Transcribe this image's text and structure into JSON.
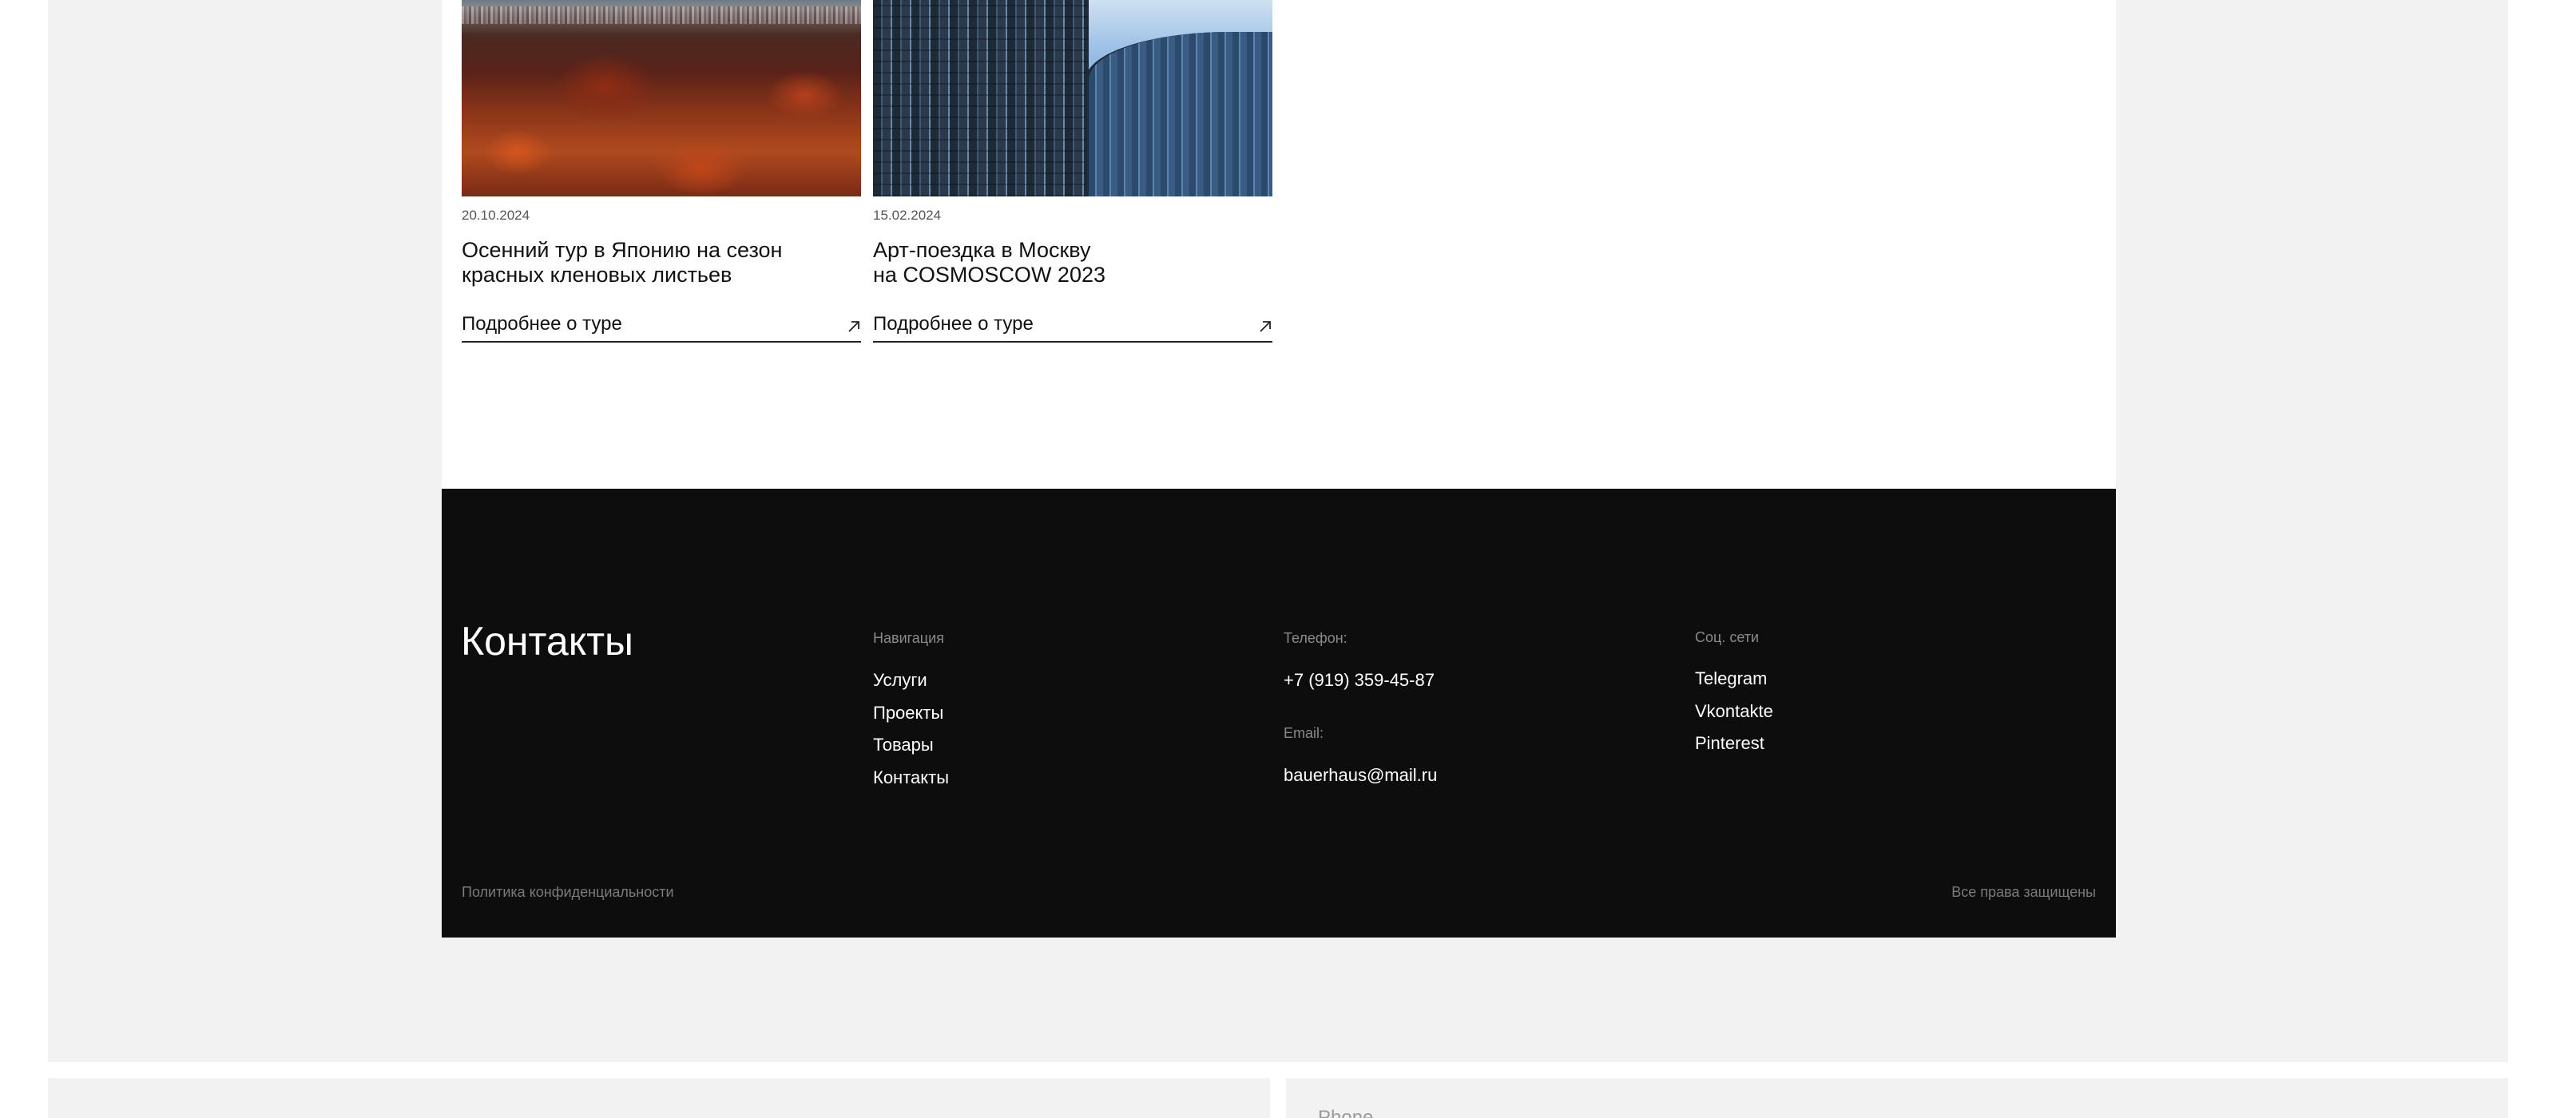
{
  "tours": [
    {
      "date": "20.10.2024",
      "title_line1": "Осенний тур в Японию на сезон",
      "title_line2": "красных кленовых листьев",
      "link_label": "Подробнее о туре",
      "image": "autumn-forest-city-photo"
    },
    {
      "date": "15.02.2024",
      "title_line1": "Арт-поездка в Москву",
      "title_line2": "на COSMOSCOW 2023",
      "link_label": "Подробнее о туре",
      "image": "glass-skyscrapers-photo"
    }
  ],
  "footer": {
    "title": "Контакты",
    "navigation": {
      "heading": "Навигация",
      "items": [
        "Услуги",
        "Проекты",
        "Товары",
        "Контакты"
      ]
    },
    "contact": {
      "phone_heading": "Телефон:",
      "phone": "+7 (919) 359-45-87",
      "email_heading": "Email:",
      "email": "bauerhaus@mail.ru"
    },
    "social": {
      "heading": "Соц. сети",
      "items": [
        "Telegram",
        "Vkontakte",
        "Pinterest"
      ]
    },
    "privacy": "Политика конфиденциальности",
    "rights": "Все права защищены"
  },
  "form": {
    "phone_placeholder": "Phone"
  },
  "icons": {
    "tour_link": "arrow-up-right-icon"
  },
  "colors": {
    "page_bg": "#f2f2f2",
    "card_bg": "#ffffff",
    "footer_bg": "#0d0d0d",
    "footer_text": "#ffffff",
    "footer_muted": "#8a8a8a"
  }
}
